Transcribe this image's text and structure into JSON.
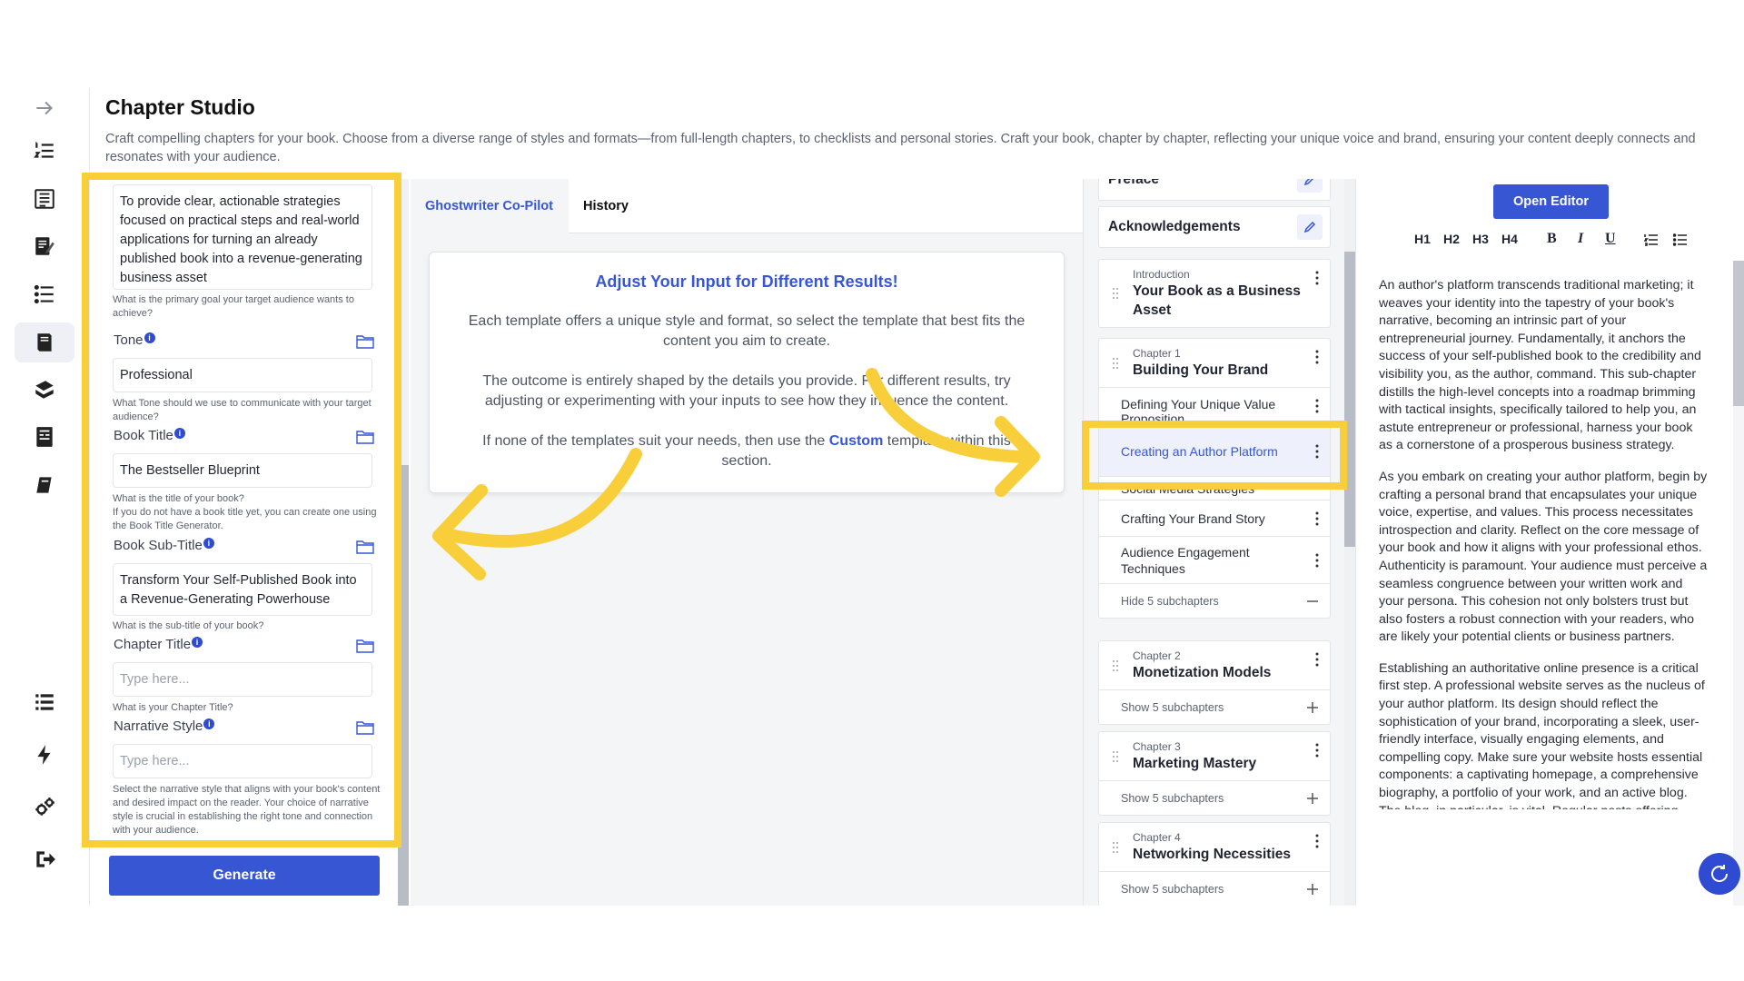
{
  "page": {
    "title": "Chapter Studio",
    "description": "Craft compelling chapters for your book. Choose from a diverse range of styles and formats—from full-length chapters, to checklists and personal stories. Craft your book, chapter by chapter, reflecting your unique voice and brand, ensuring your content deeply connects and resonates with your audience."
  },
  "rail": {
    "icons": [
      "arrow-right-icon",
      "numbered-list-icon",
      "outline-icon",
      "write-icon",
      "chapters-icon",
      "book-studio-icon",
      "books-icon",
      "layout-icon",
      "book-icon",
      "list-icon",
      "bolt-icon",
      "settings-icon",
      "logout-icon"
    ],
    "active_index": 5
  },
  "form": {
    "goal_value": "To provide clear, actionable strategies focused on practical steps and real-world applications for turning an already published book into a revenue-generating business asset",
    "goal_help": "What is the primary goal your target audience wants to achieve?",
    "tone_label": "Tone",
    "tone_value": "Professional",
    "tone_help": "What Tone should we use to communicate with your target audience?",
    "book_title_label": "Book Title",
    "book_title_value": "The Bestseller Blueprint",
    "book_title_help_1": "What is the title of your book?",
    "book_title_help_2": "If you do not have a book title yet, you can create one using the Book Title Generator.",
    "book_subtitle_label": "Book Sub-Title",
    "book_subtitle_value": "Transform Your Self-Published Book into a Revenue-Generating Powerhouse",
    "book_subtitle_help": "What is the sub-title of your book?",
    "chapter_title_label": "Chapter Title",
    "chapter_title_placeholder": "Type here...",
    "chapter_title_help": "What is your Chapter Title?",
    "narrative_label": "Narrative Style",
    "narrative_placeholder": "Type here...",
    "narrative_help": "Select the narrative style that aligns with your book's content and desired impact on the reader. Your choice of narrative style is crucial in establishing the right tone and connection with your audience.",
    "info_glyph": "i",
    "generate_label": "Generate"
  },
  "tabs": {
    "copilot": "Ghostwriter Co-Pilot",
    "history": "History"
  },
  "info_card": {
    "title": "Adjust Your Input for Different Results!",
    "p1": "Each template offers a unique style and format, so select the template that best fits the content you aim to create.",
    "p2": "The outcome is entirely shaped by the details you provide. For different results, try adjusting or experimenting with your inputs to see how they influence the content.",
    "p3_before": "If none of the templates suit your needs, then use the ",
    "p3_emph": "Custom",
    "p3_after": " template within this section."
  },
  "chapters": {
    "preface": "Preface",
    "acknowledgements": "Acknowledgements",
    "intro_kicker": "Introduction",
    "intro_name": "Your Book as a Business Asset",
    "ch1_kicker": "Chapter 1",
    "ch1_name": "Building Your Brand",
    "ch1_subs": [
      "Defining Your Unique Value Proposition",
      "Creating an Author Platform",
      "Social Media Strategies",
      "Crafting Your Brand Story",
      "Audience Engagement Techniques"
    ],
    "ch1_toggle": "Hide 5 subchapters",
    "ch2_kicker": "Chapter 2",
    "ch2_name": "Monetization Models",
    "ch2_toggle": "Show 5 subchapters",
    "ch3_kicker": "Chapter 3",
    "ch3_name": "Marketing Mastery",
    "ch3_toggle": "Show 5 subchapters",
    "ch4_kicker": "Chapter 4",
    "ch4_name": "Networking Necessities",
    "ch4_toggle": "Show 5 subchapters"
  },
  "editor": {
    "open_label": "Open Editor",
    "toolbar": {
      "h1": "H1",
      "h2": "H2",
      "h3": "H3",
      "h4": "H4",
      "bold": "B",
      "italic": "I",
      "underline": "U"
    },
    "p1": "An author's platform transcends traditional marketing; it weaves your identity into the tapestry of your book's narrative, becoming an intrinsic part of your entrepreneurial journey. Fundamentally, it anchors the success of your self-published book to the credibility and visibility you, as the author, command. This sub-chapter distills the high-level concepts into a roadmap brimming with tactical insights, specifically tailored to help you, an astute entrepreneur or professional, harness your book as a cornerstone of a prosperous business strategy.",
    "p2": "As you embark on creating your author platform, begin by crafting a personal brand that encapsulates your unique voice, expertise, and values. This process necessitates introspection and clarity. Reflect on the core message of your book and how it aligns with your professional ethos. Authenticity is paramount. Your audience must perceive a seamless congruence between your written work and your persona. This cohesion not only bolsters trust but also fosters a robust connection with your readers, who are likely your potential clients or business partners.",
    "p3": "Establishing an authoritative online presence is a critical first step. A professional website serves as the nucleus of your author platform. Its design should reflect the sophistication of your brand, incorporating a sleek, user-friendly interface, visually engaging elements, and compelling copy. Make sure your website hosts essential components: a captivating homepage, a comprehensive biography, a portfolio of your work, and an active blog. The blog, in particular, is vital. Regular posts offering valuable insights, industry updates, or personal anecdotes can amplify your"
  },
  "colors": {
    "accent": "#3756d4",
    "highlight": "#f8cf3a"
  }
}
